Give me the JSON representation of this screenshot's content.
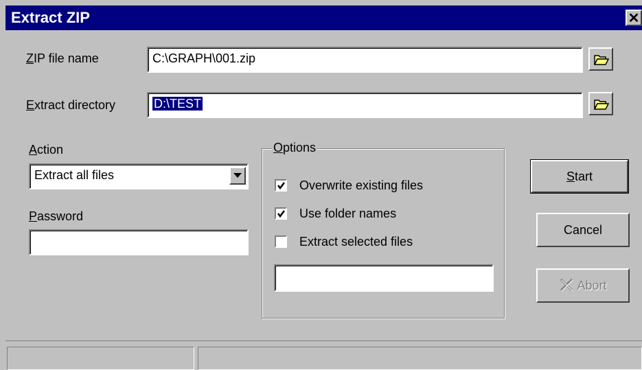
{
  "window": {
    "title": "Extract ZIP",
    "close_label": "✕"
  },
  "zip_file": {
    "label_hotkey": "Z",
    "label_rest": "IP file name",
    "value": "C:\\GRAPH\\001.zip"
  },
  "extract_dir": {
    "label_hotkey": "E",
    "label_rest": "xtract directory",
    "value": "D:\\TEST"
  },
  "action": {
    "label_hotkey": "A",
    "label_rest": "ction",
    "selected": "Extract all files"
  },
  "password": {
    "label_hotkey": "P",
    "label_rest": "assword",
    "value": ""
  },
  "options": {
    "label_hotkey": "O",
    "label_rest": "ptions",
    "items": [
      {
        "label": "Overwrite existing files",
        "checked": true
      },
      {
        "label": "Use folder names",
        "checked": true
      },
      {
        "label": "Extract selected files",
        "checked": false
      }
    ],
    "selected_files_value": ""
  },
  "buttons": {
    "start_hotkey": "S",
    "start_rest": "tart",
    "cancel": "Cancel",
    "abort": "Abort"
  },
  "icons": {
    "folder": "folder-open-icon",
    "abort": "abort-x-icon"
  },
  "colors": {
    "titlebar": "#000080",
    "face": "#c0c0c0",
    "folder": "#ffff80"
  }
}
